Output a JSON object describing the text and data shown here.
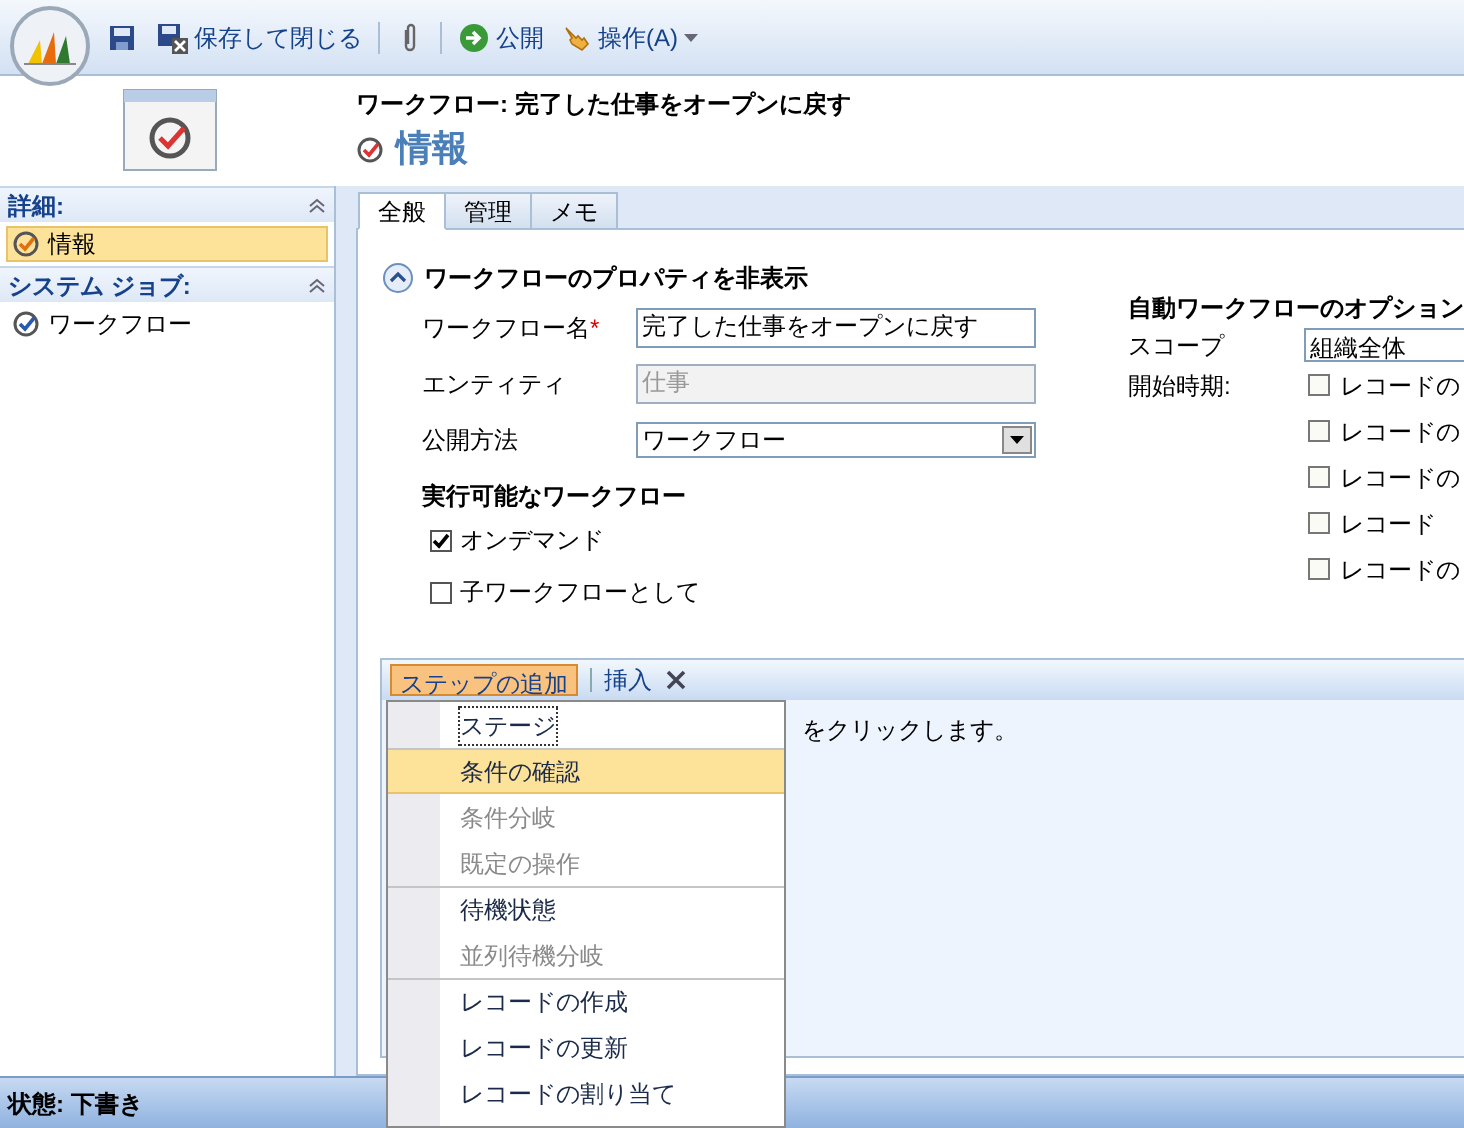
{
  "toolbar": {
    "items": [
      {
        "kind": "icon"
      },
      {
        "kind": "button",
        "label": "保存して閉じる"
      },
      {
        "kind": "separator"
      },
      {
        "kind": "icon"
      },
      {
        "kind": "separator"
      },
      {
        "kind": "button",
        "label": "公開"
      },
      {
        "kind": "menu",
        "label": "操作(A)"
      }
    ]
  },
  "header": {
    "breadcrumb": "ワークフロー: 完了した仕事をオープンに戻す",
    "title": "情報"
  },
  "sidebar": {
    "sections": [
      {
        "title": "詳細:",
        "items": [
          {
            "label": "情報",
            "selected": true
          }
        ]
      },
      {
        "title": "システム ジョブ:",
        "items": [
          {
            "label": "ワークフロー",
            "selected": false
          }
        ]
      }
    ]
  },
  "tabs": [
    {
      "label": "全般",
      "selected": true
    },
    {
      "label": "管理",
      "selected": false
    },
    {
      "label": "メモ",
      "selected": false
    }
  ],
  "properties": {
    "toggle": "ワークフローのプロパティを非表示",
    "fields": [
      {
        "kind": "text",
        "label": "ワークフロー名",
        "required_mark": "*",
        "value": "完了した仕事をオープンに戻す",
        "disabled": false
      },
      {
        "kind": "text",
        "label": "エンティティ",
        "value": "仕事",
        "disabled": true
      },
      {
        "kind": "select",
        "label": "公開方法",
        "value": "ワークフロー"
      }
    ],
    "runnable_title": "実行可能なワークフロー",
    "runnable": [
      {
        "label": "オンデマンド",
        "checked": true
      },
      {
        "label": "子ワークフローとして",
        "checked": false
      }
    ]
  },
  "auto_options": {
    "title": "自動ワークフローのオプション",
    "scope_label": "スコープ",
    "scope_value": "組織全体",
    "start_label": "開始時期:",
    "start_options": [
      {
        "label": "レコードの",
        "checked": false
      },
      {
        "label": "レコードの",
        "checked": false
      },
      {
        "label": "レコードの",
        "checked": false
      },
      {
        "label": "レコード",
        "checked": false
      },
      {
        "label": "レコードの",
        "checked": false
      }
    ]
  },
  "steps": {
    "toolbar": [
      "ステップの追加",
      "挿入"
    ],
    "hint": "をクリックします。"
  },
  "menu": [
    {
      "label": "ステージ",
      "disabled": false,
      "selected": false,
      "focused": true,
      "separator_before": false
    },
    {
      "label": "条件の確認",
      "disabled": false,
      "selected": true,
      "focused": false,
      "separator_before": true
    },
    {
      "label": "条件分岐",
      "disabled": true,
      "selected": false,
      "focused": false,
      "separator_before": false
    },
    {
      "label": "既定の操作",
      "disabled": true,
      "selected": false,
      "focused": false,
      "separator_before": false
    },
    {
      "label": "待機状態",
      "disabled": false,
      "selected": false,
      "focused": false,
      "separator_before": true
    },
    {
      "label": "並列待機分岐",
      "disabled": true,
      "selected": false,
      "focused": false,
      "separator_before": false
    },
    {
      "label": "レコードの作成",
      "disabled": false,
      "selected": false,
      "focused": false,
      "separator_before": true
    },
    {
      "label": "レコードの更新",
      "disabled": false,
      "selected": false,
      "focused": false,
      "separator_before": false
    },
    {
      "label": "レコードの割り当て",
      "disabled": false,
      "selected": false,
      "focused": false,
      "separator_before": false
    }
  ],
  "status_bar": {
    "text": "状態: 下書き"
  }
}
